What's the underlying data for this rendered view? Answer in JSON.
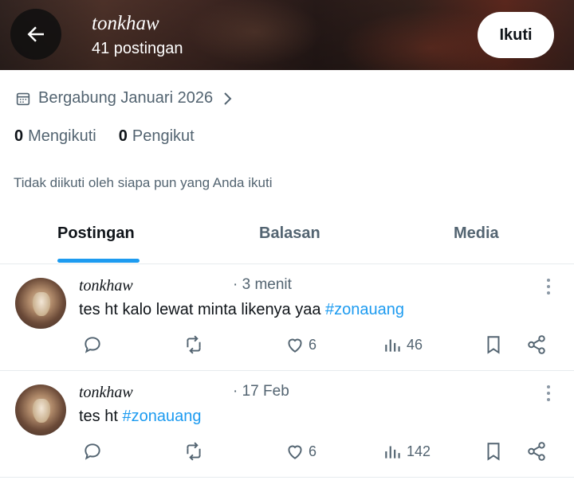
{
  "header": {
    "name": "tonkhaw",
    "post_count": "41 postingan",
    "follow_label": "Ikuti"
  },
  "profile": {
    "joined": "Bergabung Januari 2026",
    "following_count": "0",
    "following_label": "Mengikuti",
    "followers_count": "0",
    "followers_label": "Pengikut",
    "not_followed_text": "Tidak diikuti oleh siapa pun yang Anda ikuti"
  },
  "tabs": [
    {
      "label": "Postingan",
      "active": true
    },
    {
      "label": "Balasan",
      "active": false
    },
    {
      "label": "Media",
      "active": false
    }
  ],
  "posts": [
    {
      "name": "tonkhaw",
      "time": "· 3 menit",
      "text": "tes ht kalo lewat minta likenya yaa ",
      "hashtag": "#zonauang",
      "likes": "6",
      "views": "46"
    },
    {
      "name": "tonkhaw",
      "time": "· 17 Feb",
      "text": "tes ht ",
      "hashtag": "#zonauang",
      "likes": "6",
      "views": "142"
    }
  ],
  "colors": {
    "accent": "#1d9bf0",
    "secondary_text": "#536471",
    "primary_text": "#0f1419"
  }
}
